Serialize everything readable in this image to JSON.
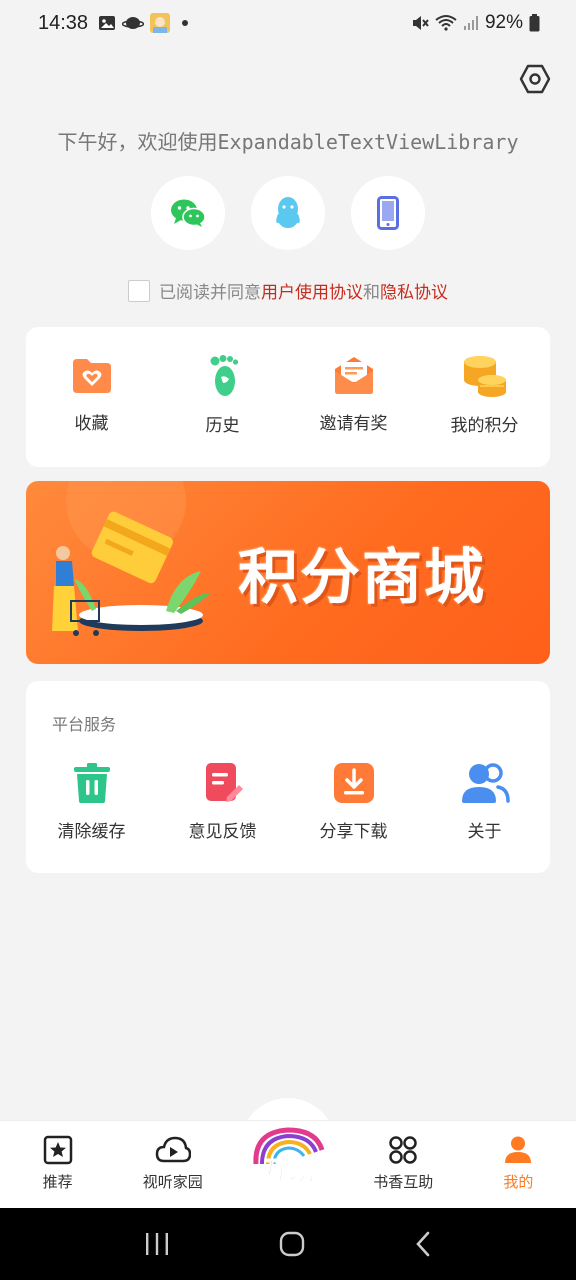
{
  "status_bar": {
    "time": "14:38",
    "battery": "92%"
  },
  "header": {
    "greeting": "下午好，欢迎使用ExpandableTextViewLibrary"
  },
  "login": {
    "options": [
      "wechat-icon",
      "qq-icon",
      "phone-icon"
    ]
  },
  "agreement": {
    "prefix": "已阅读并同意",
    "user_agreement": "用户使用协议",
    "and": "和",
    "privacy": "隐私协议"
  },
  "quick_actions": [
    {
      "label": "收藏",
      "icon": "folder-heart-icon"
    },
    {
      "label": "历史",
      "icon": "footprint-icon"
    },
    {
      "label": "邀请有奖",
      "icon": "envelope-icon"
    },
    {
      "label": "我的积分",
      "icon": "coins-icon"
    }
  ],
  "banner": {
    "text": "积分商城"
  },
  "services": {
    "title": "平台服务",
    "items": [
      {
        "label": "清除缓存",
        "icon": "trash-icon"
      },
      {
        "label": "意见反馈",
        "icon": "feedback-icon"
      },
      {
        "label": "分享下载",
        "icon": "download-icon"
      },
      {
        "label": "关于",
        "icon": "users-icon"
      }
    ]
  },
  "nav": {
    "items": [
      {
        "label": "推荐",
        "icon": "star-icon"
      },
      {
        "label": "视听家园",
        "icon": "cloud-play-icon"
      },
      {
        "label": "",
        "icon": "center-logo"
      },
      {
        "label": "书香互助",
        "icon": "grid-icon"
      },
      {
        "label": "我的",
        "icon": "person-icon"
      }
    ],
    "center_logo_text": "互助",
    "active": "我的"
  },
  "colors": {
    "accent": "#ff7b22",
    "link": "#c62c1e",
    "background": "#f3f3f3"
  }
}
